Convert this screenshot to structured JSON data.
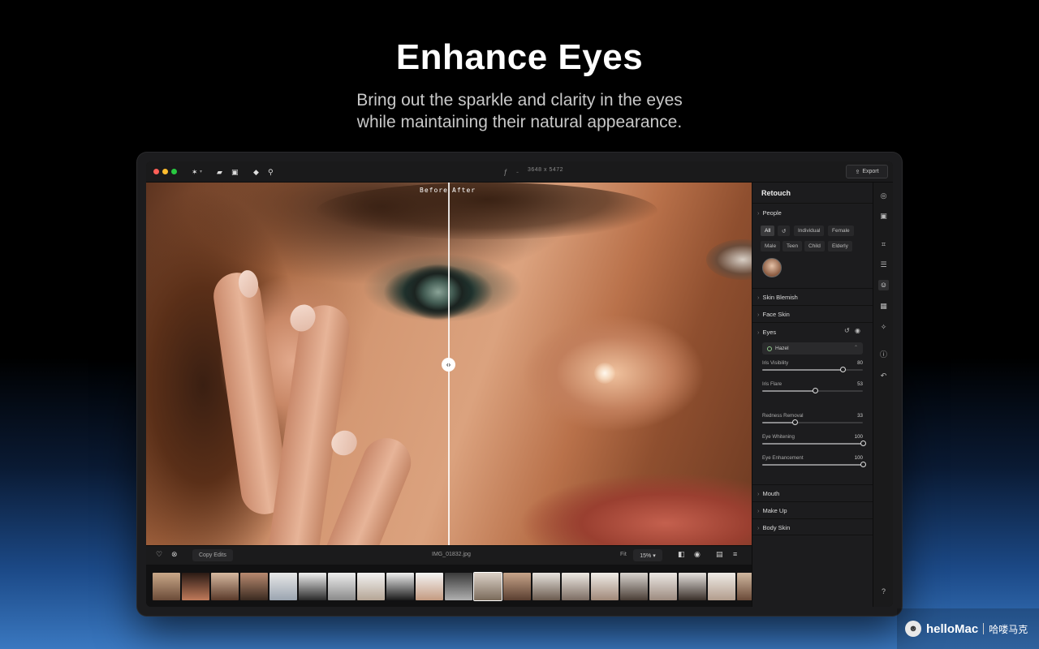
{
  "hero": {
    "title": "Enhance Eyes",
    "subtitle_line1": "Bring out the sparkle and clarity in the eyes",
    "subtitle_line2": "while maintaining their natural appearance."
  },
  "toolbar": {
    "dimensions": "3648  x  5472",
    "export_label": "Export"
  },
  "canvas": {
    "before_label": "Before",
    "after_label": "After"
  },
  "bottombar": {
    "copy_edits_label": "Copy Edits",
    "filename": "IMG_01832.jpg",
    "fit_label": "Fit",
    "zoom_value": "15% ▾"
  },
  "panel": {
    "title": "Retouch",
    "people": {
      "header": "People",
      "chips_row1": [
        "All",
        "↺",
        "Individual",
        "Female"
      ],
      "chips_row2": [
        "Male",
        "Teen",
        "Child",
        "Elderly"
      ]
    },
    "sections": {
      "skin_blemish": "Skin Blemish",
      "face_skin": "Face Skin",
      "eyes": "Eyes",
      "mouth": "Mouth",
      "make_up": "Make Up",
      "body_skin": "Body Skin"
    },
    "eyes": {
      "eye_color": "Hazel",
      "sliders": [
        {
          "label": "Iris Visibility",
          "value": 80
        },
        {
          "label": "Iris Flare",
          "value": 53
        },
        {
          "label": "Redness Removal",
          "value": 33
        },
        {
          "label": "Eye Whitening",
          "value": 100
        },
        {
          "label": "Eye Enhancement",
          "value": 100
        }
      ]
    }
  },
  "watermark": {
    "brand": "helloMac",
    "chinese": "哈喽马克"
  },
  "colors": {
    "accent_selected": "#3a3a3c",
    "traffic_red": "#ff5f57",
    "traffic_yellow": "#febc2e",
    "traffic_green": "#28c840"
  }
}
